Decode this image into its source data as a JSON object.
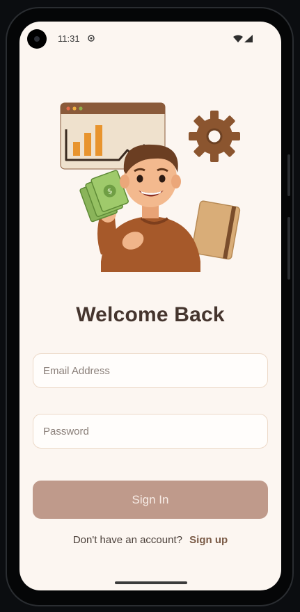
{
  "status_bar": {
    "time": "11:31",
    "icons": [
      "camera-icon",
      "notification-icon",
      "wifi-icon",
      "signal-icon"
    ]
  },
  "illustration": {
    "name": "finance-character-illustration"
  },
  "login": {
    "title": "Welcome Back",
    "email_placeholder": "Email Address",
    "password_placeholder": "Password",
    "signin_label": "Sign In",
    "signup_prompt": "Don't have an account?",
    "signup_link": "Sign up"
  },
  "colors": {
    "background": "#fcf6f1",
    "title": "#45352e",
    "button": "#bf9a8b",
    "link": "#7a5a46"
  }
}
